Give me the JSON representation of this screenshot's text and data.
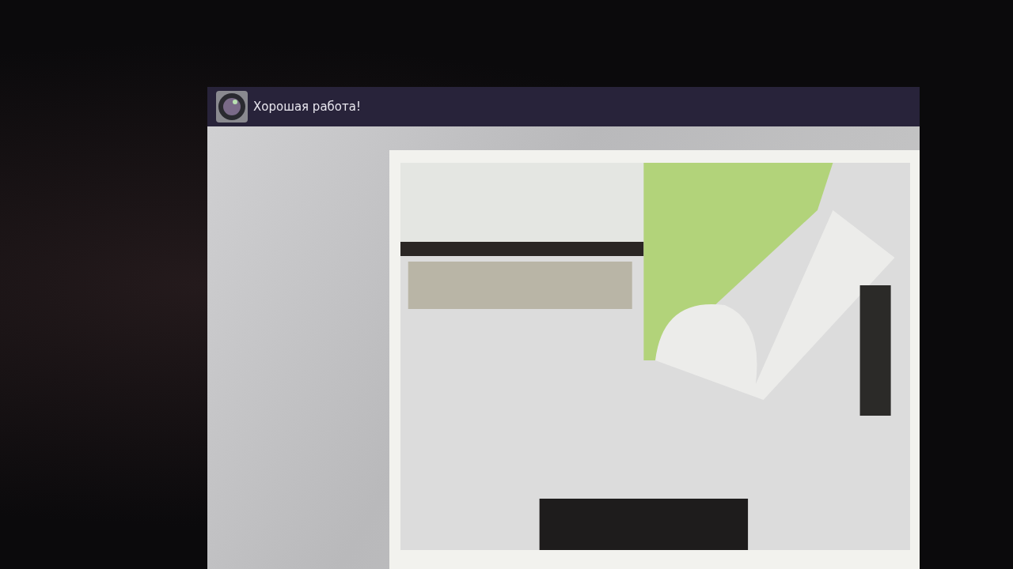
{
  "app_bar": {
    "title": "Хорошая работа!"
  }
}
